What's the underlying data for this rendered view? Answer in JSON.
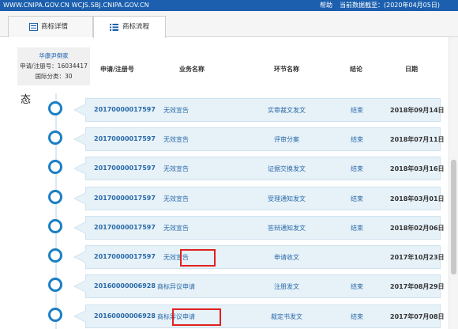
{
  "topbar": {
    "site": "WWW.CNIPA.GOV.CN WCJS.SBJ.CNIPA.GOV.CN",
    "help": "帮助",
    "as_of": "当前数据截至：(2020年04月05日)"
  },
  "tabs": [
    {
      "label": "商标详情",
      "icon": "document-icon"
    },
    {
      "label": "商标流程",
      "icon": "list-icon"
    }
  ],
  "card": {
    "name": "华康尹倒家",
    "reg_no": "申请/注册号：16034417",
    "class": "国际分类：30"
  },
  "table": {
    "columns": [
      "申请/注册号",
      "业务名称",
      "环节名称",
      "结论",
      "日期"
    ],
    "timeline_label": "态",
    "rows": [
      {
        "reg": "20170000017597",
        "biz": "无效宣告",
        "step": "实审裁文发文",
        "result": "结束",
        "date": "2018年09月14日"
      },
      {
        "reg": "20170000017597",
        "biz": "无效宣告",
        "step": "评审分案",
        "result": "结束",
        "date": "2018年07月11日"
      },
      {
        "reg": "20170000017597",
        "biz": "无效宣告",
        "step": "证据交换发文",
        "result": "结束",
        "date": "2018年03月16日"
      },
      {
        "reg": "20170000017597",
        "biz": "无效宣告",
        "step": "受理通知发文",
        "result": "结束",
        "date": "2018年03月01日"
      },
      {
        "reg": "20170000017597",
        "biz": "无效宣告",
        "step": "答辩通知发文",
        "result": "结束",
        "date": "2018年02月06日"
      },
      {
        "reg": "20170000017597",
        "biz": "无效宣告",
        "step": "申请收文",
        "result": "",
        "date": "2017年10月23日"
      },
      {
        "reg": "20160000006928",
        "biz": "商标异议申请",
        "step": "注册发文",
        "result": "结束",
        "date": "2017年08月29日"
      },
      {
        "reg": "20160000006928",
        "biz": "商标异议申请",
        "step": "裁定书发文",
        "result": "结束",
        "date": "2017年07月08日"
      }
    ]
  },
  "colors": {
    "brand_blue": "#1b5fae",
    "row_bg": "#e6f1f8",
    "highlight": "#e02020"
  }
}
